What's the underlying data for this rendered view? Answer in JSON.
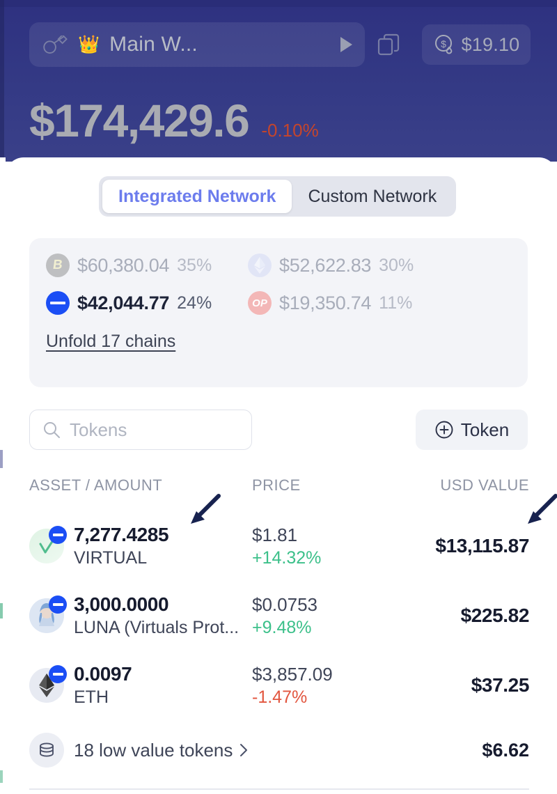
{
  "header": {
    "key_icon": "key-icon",
    "crown_emoji": "👑",
    "wallet_name": "Main W...",
    "expand_icon": "play-triangle-icon",
    "copy_icon": "copy-icon",
    "gas_icon": "gas-dollar-icon",
    "gas_amount": "$19.10",
    "balance": "$174,429.6",
    "balance_change": "-0.10%",
    "balance_change_color": "#c4452c"
  },
  "tabs": [
    {
      "label": "Integrated Network",
      "active": true
    },
    {
      "label": "Custom Network",
      "active": false
    }
  ],
  "chains": {
    "items": [
      {
        "name": "bnb-chain",
        "value": "$60,380.04",
        "pct": "35%",
        "active": false
      },
      {
        "name": "ethereum",
        "value": "$52,622.83",
        "pct": "30%",
        "active": false
      },
      {
        "name": "base",
        "value": "$42,044.77",
        "pct": "24%",
        "active": true
      },
      {
        "name": "optimism",
        "value": "$19,350.74",
        "pct": "11%",
        "active": false
      }
    ],
    "unfold_label": "Unfold 17 chains"
  },
  "toolbar": {
    "search_placeholder": "Tokens",
    "search_value": "",
    "search_icon": "search-icon",
    "add_token_label": "Token",
    "add_token_icon": "plus-circle-icon"
  },
  "table": {
    "headers": {
      "asset": "ASSET / AMOUNT",
      "price": "PRICE",
      "usd": "USD VALUE"
    },
    "rows": [
      {
        "icon": "virtual-token-icon",
        "badge": "base-chain-badge",
        "amount": "7,277.4285",
        "symbol": "VIRTUAL",
        "price": "$1.81",
        "change": "+14.32%",
        "direction": "up",
        "usd": "$13,115.87"
      },
      {
        "icon": "luna-token-icon",
        "badge": "base-chain-badge",
        "amount": "3,000.0000",
        "symbol": "LUNA (Virtuals Prot...",
        "price": "$0.0753",
        "change": "+9.48%",
        "direction": "up",
        "usd": "$225.82"
      },
      {
        "icon": "eth-token-icon",
        "badge": "base-chain-badge",
        "amount": "0.0097",
        "symbol": "ETH",
        "price": "$3,857.09",
        "change": "-1.47%",
        "direction": "down",
        "usd": "$37.25"
      }
    ],
    "low_value": {
      "icon": "coin-stack-icon",
      "label": "18 low value tokens",
      "chevron": "chevron-right-icon",
      "usd": "$6.62"
    }
  },
  "annotations": [
    {
      "name": "arrow-pointer-amount",
      "color": "#17224f"
    },
    {
      "name": "arrow-pointer-usd-value",
      "color": "#17224f"
    }
  ],
  "colors": {
    "header_bg": "#343a85",
    "accent": "#6c7ced",
    "positive": "#3cc08a",
    "negative": "#e2563f",
    "base_blue": "#1b4ef5"
  }
}
